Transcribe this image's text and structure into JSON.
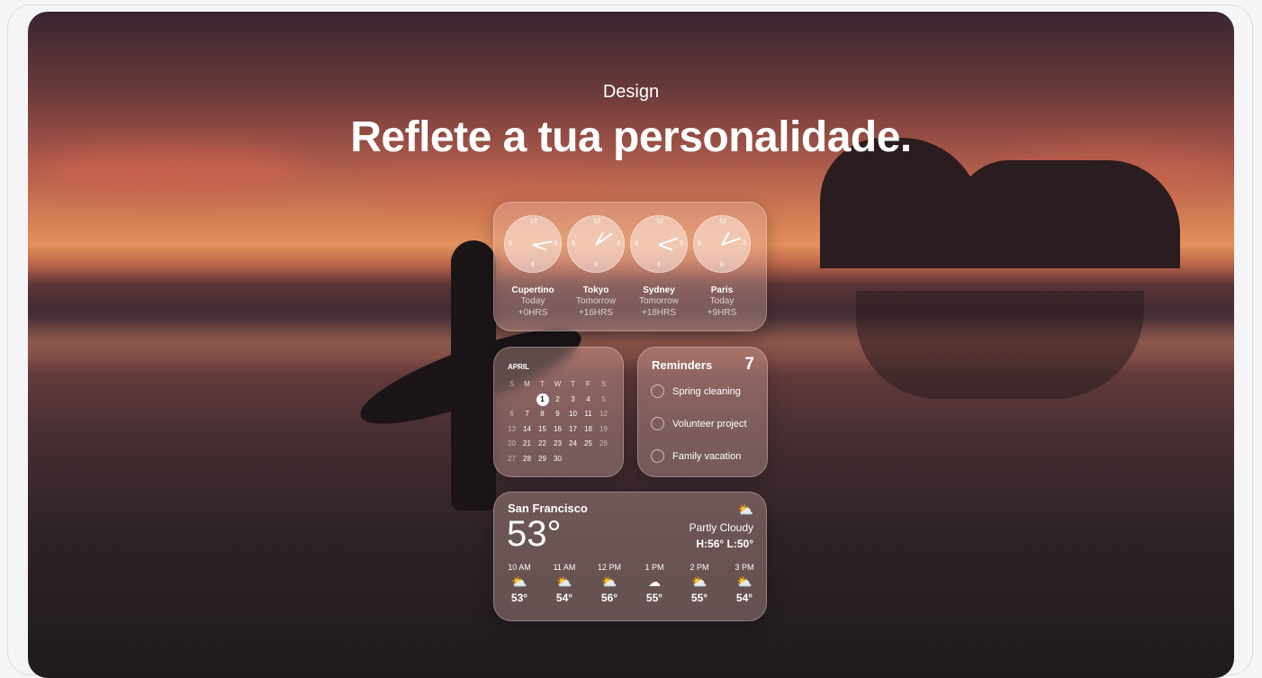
{
  "header": {
    "kicker": "Design",
    "title": "Reflete a tua personalidade."
  },
  "world_clock": {
    "clocks": [
      {
        "city": "Cupertino",
        "day": "Today",
        "offset": "+0HRS"
      },
      {
        "city": "Tokyo",
        "day": "Tomorrow",
        "offset": "+16HRS"
      },
      {
        "city": "Sydney",
        "day": "Tomorrow",
        "offset": "+18HRS"
      },
      {
        "city": "Paris",
        "day": "Today",
        "offset": "+9HRS"
      }
    ]
  },
  "calendar": {
    "month": "APRIL",
    "weekdays": [
      "S",
      "M",
      "T",
      "W",
      "T",
      "F",
      "S"
    ],
    "weeks": [
      [
        "",
        "",
        "",
        "1",
        "2",
        "3",
        "4",
        "5"
      ],
      [
        "6",
        "7",
        "8",
        "9",
        "10",
        "11",
        "12"
      ],
      [
        "13",
        "14",
        "15",
        "16",
        "17",
        "18",
        "19"
      ],
      [
        "20",
        "21",
        "22",
        "23",
        "24",
        "25",
        "26"
      ],
      [
        "27",
        "28",
        "29",
        "30",
        "",
        "",
        ""
      ]
    ],
    "today": "1"
  },
  "reminders": {
    "title": "Reminders",
    "count": "7",
    "items": [
      "Spring cleaning",
      "Volunteer project",
      "Family vacation"
    ]
  },
  "weather": {
    "city": "San Francisco",
    "temp": "53°",
    "icon": "partly-cloudy-icon",
    "condition": "Partly Cloudy",
    "hilo": "H:56° L:50°",
    "hours": [
      {
        "time": "10 AM",
        "icon": "partly-cloudy-icon",
        "temp": "53°"
      },
      {
        "time": "11 AM",
        "icon": "partly-cloudy-icon",
        "temp": "54°"
      },
      {
        "time": "12 PM",
        "icon": "partly-cloudy-icon",
        "temp": "56°"
      },
      {
        "time": "1 PM",
        "icon": "cloud-icon",
        "temp": "55°"
      },
      {
        "time": "2 PM",
        "icon": "partly-cloudy-icon",
        "temp": "55°"
      },
      {
        "time": "3 PM",
        "icon": "partly-cloudy-icon",
        "temp": "54°"
      }
    ]
  },
  "colors": {
    "page_bg": "#f5f5f7",
    "text": "#ffffff"
  }
}
